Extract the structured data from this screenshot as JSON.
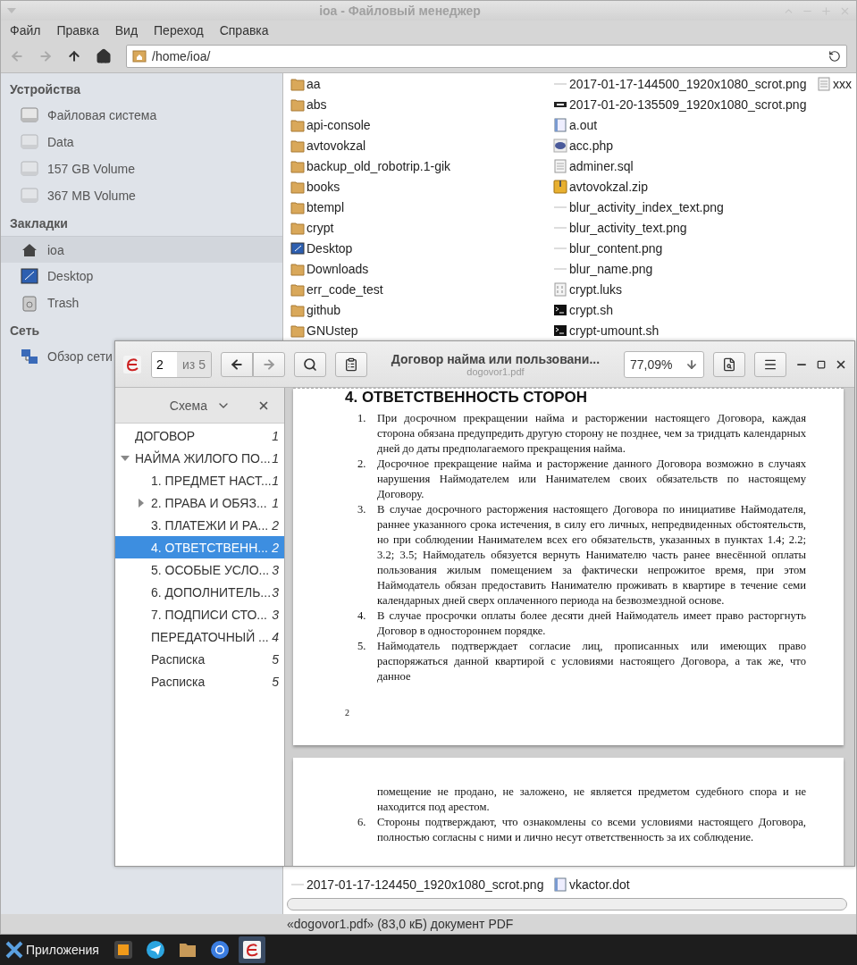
{
  "file_manager": {
    "window": {
      "title": "ioa - Файловый менеджер"
    },
    "menu": [
      "Файл",
      "Правка",
      "Вид",
      "Переход",
      "Справка"
    ],
    "address": "/home/ioa/",
    "sidebar": {
      "sections": [
        {
          "title": "Устройства",
          "items": [
            {
              "label": "Файловая система",
              "kind": "drive",
              "mounted": true,
              "selected": false
            },
            {
              "label": "Data",
              "kind": "drive",
              "mounted": false,
              "selected": false
            },
            {
              "label": "157 GB Volume",
              "kind": "drive",
              "mounted": false,
              "selected": false
            },
            {
              "label": "367 MB Volume",
              "kind": "drive",
              "mounted": false,
              "selected": false
            }
          ]
        },
        {
          "title": "Закладки",
          "items": [
            {
              "label": "ioa",
              "kind": "home",
              "selected": true
            },
            {
              "label": "Desktop",
              "kind": "desktop",
              "selected": false
            },
            {
              "label": "Trash",
              "kind": "trash",
              "selected": false
            }
          ]
        },
        {
          "title": "Сеть",
          "items": [
            {
              "label": "Обзор сети",
              "kind": "network",
              "selected": false
            }
          ]
        }
      ]
    },
    "files": {
      "columns": [
        [
          {
            "name": "aa",
            "kind": "folder"
          },
          {
            "name": "abs",
            "kind": "folder"
          },
          {
            "name": "api-console",
            "kind": "folder"
          },
          {
            "name": "avtovokzal",
            "kind": "folder"
          },
          {
            "name": "backup_old_robotrip.1-gik",
            "kind": "folder"
          },
          {
            "name": "books",
            "kind": "folder"
          },
          {
            "name": "btempl",
            "kind": "folder"
          },
          {
            "name": "crypt",
            "kind": "folder"
          },
          {
            "name": "Desktop",
            "kind": "desktop"
          },
          {
            "name": "Downloads",
            "kind": "folder"
          },
          {
            "name": "err_code_test",
            "kind": "folder"
          },
          {
            "name": "github",
            "kind": "folder"
          },
          {
            "name": "GNUstep",
            "kind": "folder"
          }
        ],
        [
          {
            "name": "2017-01-17-144500_1920x1080_scrot.png",
            "kind": "image"
          },
          {
            "name": "2017-01-20-135509_1920x1080_scrot.png",
            "kind": "dark-image"
          },
          {
            "name": "a.out",
            "kind": "document"
          },
          {
            "name": "acc.php",
            "kind": "php"
          },
          {
            "name": "adminer.sql",
            "kind": "text"
          },
          {
            "name": "avtovokzal.zip",
            "kind": "archive"
          },
          {
            "name": "blur_activity_index_text.png",
            "kind": "image"
          },
          {
            "name": "blur_activity_text.png",
            "kind": "image"
          },
          {
            "name": "blur_content.png",
            "kind": "image"
          },
          {
            "name": "blur_name.png",
            "kind": "image"
          },
          {
            "name": "crypt.luks",
            "kind": "binary"
          },
          {
            "name": "crypt.sh",
            "kind": "script"
          },
          {
            "name": "crypt-umount.sh",
            "kind": "script"
          }
        ],
        [
          {
            "name": "xxx",
            "kind": "text"
          }
        ]
      ],
      "bottom_row": [
        {
          "name": "2017-01-17-124450_1920x1080_scrot.png",
          "kind": "image"
        },
        {
          "name": "vkactor.dot",
          "kind": "document"
        }
      ]
    },
    "status_bar": "«dogovor1.pdf» (83,0 кБ) документ PDF"
  },
  "pdf_viewer": {
    "page": "2",
    "page_count": "из 5",
    "title": "Договор найма или пользовани...",
    "filename": "dogovor1.pdf",
    "zoom": "77,09%",
    "outline": {
      "title": "Схема",
      "items": [
        {
          "label": "ДОГОВОР",
          "page": "1",
          "selected": false
        },
        {
          "label": "НАЙМА ЖИЛОГО ПО...",
          "page": "1",
          "selected": false,
          "expanded": true,
          "children": [
            {
              "label": "1. ПРЕДМЕТ НАСТ...",
              "page": "1",
              "selected": false
            },
            {
              "label": "2. ПРАВА И ОБЯЗ...",
              "page": "1",
              "selected": false,
              "expanded": false
            },
            {
              "label": "3. ПЛАТЕЖИ И РА...",
              "page": "2",
              "selected": false
            },
            {
              "label": "4. ОТВЕТСТВЕНН...",
              "page": "2",
              "selected": true
            },
            {
              "label": "5. ОСОБЫЕ УСЛО...",
              "page": "3",
              "selected": false
            },
            {
              "label": "6. ДОПОЛНИТЕЛЬ...",
              "page": "3",
              "selected": false
            },
            {
              "label": "7. ПОДПИСИ СТО...",
              "page": "3",
              "selected": false
            },
            {
              "label": "ПЕРЕДАТОЧНЫЙ ...",
              "page": "4",
              "selected": false
            },
            {
              "label": "Расписка",
              "page": "5",
              "selected": false
            },
            {
              "label": "Расписка",
              "page": "5",
              "selected": false
            }
          ]
        }
      ]
    },
    "pages": [
      {
        "blocks": [
          {
            "kind": "heading",
            "text": "4. ОТВЕТСТВЕННОСТЬ СТОРОН"
          },
          {
            "kind": "item",
            "number": "1.",
            "text": "При досрочном прекращении найма и расторжении настоящего Договора, каждая сторона обязана предупредить другую сторону не позднее, чем за тридцать календарных дней до даты предполагаемого прекращения найма."
          },
          {
            "kind": "item",
            "number": "2.",
            "text": "Досрочное прекращение найма и расторжение данного Договора возможно в случаях нарушения Наймодателем или Нанимателем своих обязательств по настоящему Договору."
          },
          {
            "kind": "item",
            "number": "3.",
            "text": "В случае досрочного расторжения настоящего Договора по инициативе Наймодателя, раннее указанного срока истечения, в силу его личных, непредвиденных обстоятельств, но при соблюдении Нанимателем всех его обязательств, указанных в пунктах 1.4; 2.2; 3.2; 3.5; Наймодатель обязуется вернуть Нанимателю часть ранее внесённой оплаты пользования жилым помещением за фактически непрожитое время,  при этом Наймодатель обязан предоставить Нанимателю проживать  в квартире в течение семи календарных дней сверх оплаченного периода на безвозмездной основе."
          },
          {
            "kind": "item",
            "number": "4.",
            "text": "В случае просрочки оплаты более десяти дней Наймодатель имеет право расторгнуть Договор в одностороннем порядке."
          },
          {
            "kind": "item",
            "number": "5.",
            "text": "Наймодатель подтверждает согласие лиц, прописанных или имеющих право распоряжаться данной квартирой с условиями настоящего Договора, а так же, что данное"
          }
        ],
        "footer": "2"
      },
      {
        "blocks": [
          {
            "kind": "para",
            "text": "помещение не продано, не заложено, не является предметом судебного спора и не находится под арестом."
          },
          {
            "kind": "item",
            "number": "6.",
            "text": "Стороны подтверждают, что ознакомлены со всеми условиями настоящего Договора, полностью согласны с ними и лично несут ответственность за их соблюдение."
          }
        ]
      }
    ]
  },
  "taskbar": {
    "start": "Приложения",
    "apps": [
      {
        "kind": "editor",
        "active": false
      },
      {
        "kind": "messenger",
        "active": false
      },
      {
        "kind": "files",
        "active": false
      },
      {
        "kind": "browser",
        "active": false
      },
      {
        "kind": "pdf",
        "active": true
      }
    ]
  }
}
